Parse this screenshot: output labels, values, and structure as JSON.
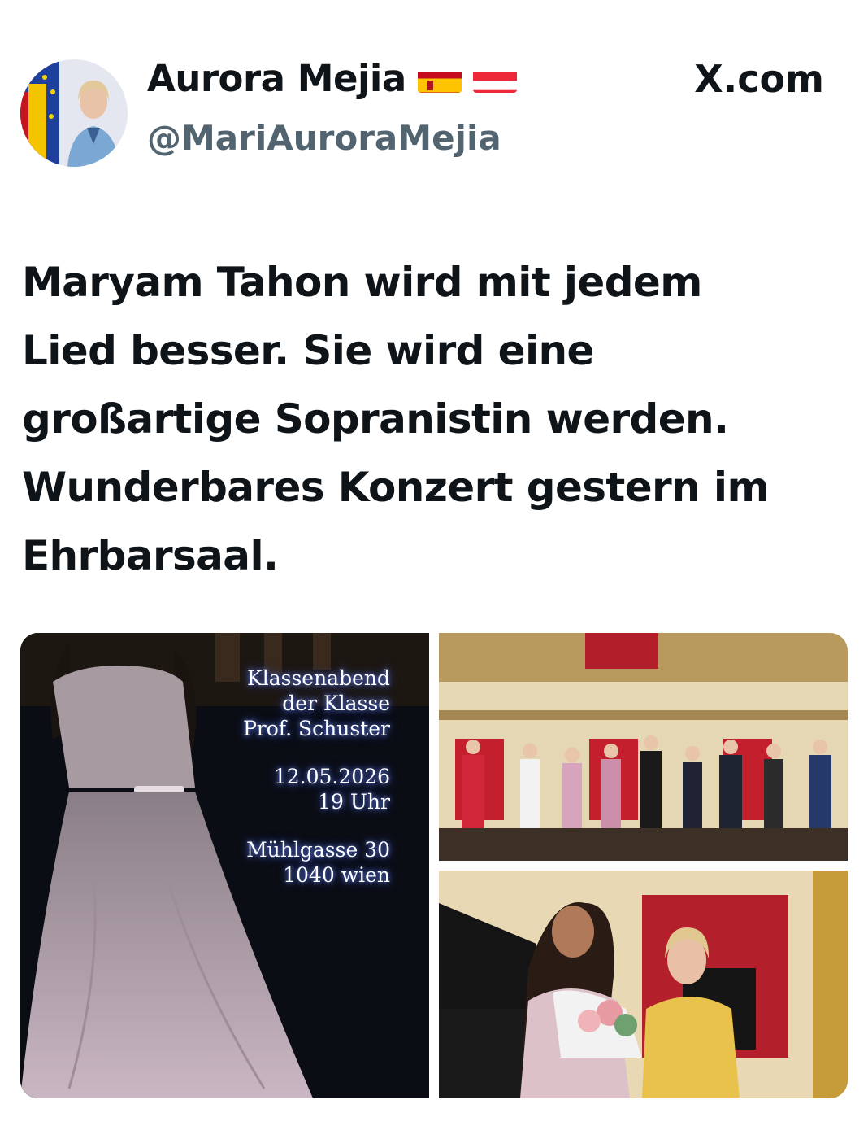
{
  "header": {
    "name": "Aurora Mejia",
    "handle": "@MariAuroraMejia",
    "site": "X.com",
    "flags": [
      "flag-spain-icon",
      "flag-austria-icon"
    ]
  },
  "tweet": {
    "lines": [
      "Maryam Tahon wird mit jedem",
      "Lied besser. Sie wird eine",
      "großartige Sopranistin werden.",
      "Wunderbares Konzert gestern im",
      "Ehrbarsaal."
    ]
  },
  "poster": {
    "title_1": "Klassenabend",
    "title_2": "der Klasse",
    "title_3": "Prof. Schuster",
    "date": "12.05.2026",
    "time": "19 Uhr",
    "street": "Mühlgasse 30",
    "city": "1040 wien"
  },
  "colors": {
    "text": "#0f1419",
    "secondary": "#536471",
    "poster_glow": "#5e78d8"
  }
}
